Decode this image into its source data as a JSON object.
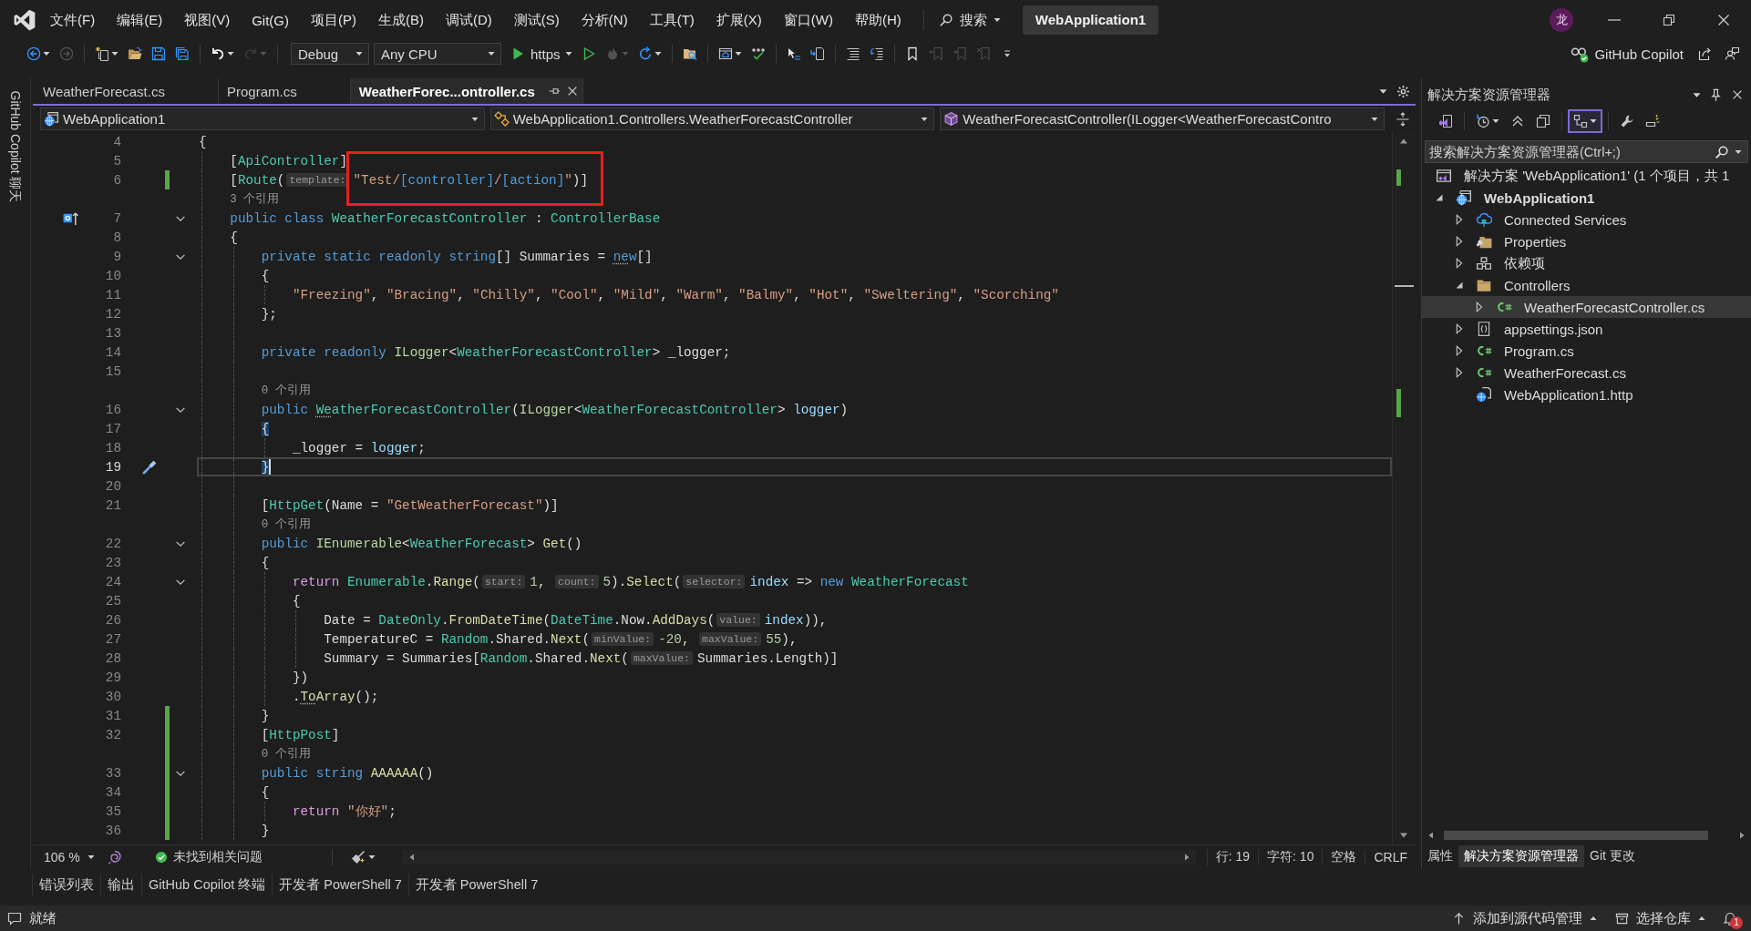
{
  "title_bar": {
    "menu": [
      "文件(F)",
      "编辑(E)",
      "视图(V)",
      "Git(G)",
      "项目(P)",
      "生成(B)",
      "调试(D)",
      "测试(S)",
      "分析(N)",
      "工具(T)",
      "扩展(X)",
      "窗口(W)",
      "帮助(H)"
    ],
    "search": "搜索",
    "solution": "WebApplication1",
    "avatar": "龙"
  },
  "toolbar": {
    "groups": [
      [
        {
          "kind": "back",
          "disabled": false,
          "menu": true
        },
        {
          "kind": "forward",
          "disabled": true
        }
      ],
      [
        {
          "kind": "new-item",
          "disabled": false,
          "menu": true
        },
        {
          "kind": "open",
          "disabled": false
        },
        {
          "kind": "save",
          "disabled": false
        },
        {
          "kind": "save-all",
          "disabled": false
        }
      ],
      [
        {
          "kind": "undo",
          "disabled": false,
          "menu": true
        },
        {
          "kind": "redo",
          "disabled": true,
          "menu": true
        }
      ],
      [
        {
          "kind": "config-combo",
          "label": "Debug"
        },
        {
          "kind": "platform-combo",
          "label": "Any CPU"
        },
        {
          "kind": "run",
          "label": "https",
          "disabled": false,
          "menu": true
        },
        {
          "kind": "run-outline",
          "disabled": false
        },
        {
          "kind": "hot-reload",
          "disabled": true,
          "menu": true
        },
        {
          "kind": "restart",
          "disabled": false,
          "menu": true
        }
      ],
      [
        {
          "kind": "find-files",
          "disabled": false
        }
      ],
      [
        {
          "kind": "browser",
          "disabled": false,
          "menu": true
        },
        {
          "kind": "spell-check",
          "disabled": false
        }
      ],
      [
        {
          "kind": "select-tool",
          "disabled": false
        },
        {
          "kind": "step-tool",
          "disabled": false
        }
      ],
      [
        {
          "kind": "comment",
          "disabled": false
        },
        {
          "kind": "uncomment",
          "disabled": false
        }
      ],
      [
        {
          "kind": "bookmark",
          "disabled": false
        },
        {
          "kind": "prev-bookmark",
          "disabled": true
        },
        {
          "kind": "next-bookmark",
          "disabled": true
        },
        {
          "kind": "clear-bookmarks",
          "disabled": true
        },
        {
          "kind": "overflow",
          "disabled": false
        }
      ]
    ],
    "copilot": "GitHub Copilot"
  },
  "side_strip": {
    "label": "GitHub Copilot 聊天"
  },
  "editor": {
    "tabs": [
      {
        "label": "WeatherForecast.cs",
        "selected": false
      },
      {
        "label": "Program.cs",
        "selected": false
      },
      {
        "label": "WeatherForec...ontroller.cs",
        "selected": true
      }
    ],
    "nav_bar": [
      {
        "kind": "project",
        "label": "WebApplication1"
      },
      {
        "kind": "type",
        "label": "WebApplication1.Controllers.WeatherForecastController"
      },
      {
        "kind": "member",
        "label": "WeatherForecastController(ILogger<WeatherForecastContro"
      }
    ],
    "lines": [
      {
        "kind": "code",
        "number": "4",
        "tokens": [
          {
            "kind": "plain",
            "text": "{"
          }
        ],
        "changed": false,
        "fold": false,
        "current": false,
        "children": [
          {
            "kind": "code",
            "number": "5",
            "tokens": [
              {
                "kind": "plain",
                "text": "["
              },
              {
                "kind": "type",
                "text": "ApiController"
              },
              {
                "kind": "plain",
                "text": "]"
              }
            ],
            "changed": false,
            "fold": false,
            "current": false
          },
          {
            "kind": "code",
            "number": "6",
            "tokens": [
              {
                "kind": "plain",
                "text": "["
              },
              {
                "kind": "type",
                "text": "Route"
              },
              {
                "kind": "plain",
                "text": "("
              },
              {
                "kind": "hint",
                "text": "template:"
              },
              {
                "kind": "str",
                "text": "\"Test/",
                "highlighted": true
              },
              {
                "kind": "route",
                "text": "[controller]",
                "highlighted": true
              },
              {
                "kind": "str",
                "text": "/",
                "highlighted": true
              },
              {
                "kind": "route",
                "text": "[action]",
                "highlighted": true
              },
              {
                "kind": "str",
                "text": "\"",
                "highlighted": true
              },
              {
                "kind": "plain",
                "text": ")]",
                "highlighted": true
              }
            ],
            "changed": true,
            "fold": false,
            "current": false
          },
          {
            "kind": "codelens",
            "text": "3 个引用",
            "changed": false
          },
          {
            "kind": "code",
            "number": "7",
            "tokens": [
              {
                "kind": "kw",
                "text": "public class "
              },
              {
                "kind": "type",
                "text": "WeatherForecastController"
              },
              {
                "kind": "plain",
                "text": " : "
              },
              {
                "kind": "type",
                "text": "ControllerBase"
              }
            ],
            "changed": false,
            "fold": true,
            "current": false,
            "glyph": {
              "kind": "implements"
            }
          },
          {
            "kind": "code",
            "number": "8",
            "tokens": [
              {
                "kind": "plain",
                "text": "{"
              }
            ],
            "changed": false,
            "fold": false,
            "current": false,
            "children": [
              {
                "kind": "code",
                "number": "9",
                "tokens": [
                  {
                    "kind": "kw",
                    "text": "private static readonly string"
                  },
                  {
                    "kind": "plain",
                    "text": "[] Summaries = "
                  },
                  {
                    "kind": "kw",
                    "text": "ne",
                    "dotted": true
                  },
                  {
                    "kind": "kw",
                    "text": "w"
                  },
                  {
                    "kind": "plain",
                    "text": "[]"
                  }
                ],
                "changed": false,
                "fold": true,
                "current": false
              },
              {
                "kind": "code",
                "number": "10",
                "tokens": [
                  {
                    "kind": "plain",
                    "text": "{"
                  }
                ],
                "changed": false,
                "fold": false,
                "current": false,
                "children": [
                  {
                    "kind": "code",
                    "number": "11",
                    "tokens": [
                      {
                        "kind": "str",
                        "text": "\"Freezing\""
                      },
                      {
                        "kind": "plain",
                        "text": ", "
                      },
                      {
                        "kind": "str",
                        "text": "\"Bracing\""
                      },
                      {
                        "kind": "plain",
                        "text": ", "
                      },
                      {
                        "kind": "str",
                        "text": "\"Chilly\""
                      },
                      {
                        "kind": "plain",
                        "text": ", "
                      },
                      {
                        "kind": "str",
                        "text": "\"Cool\""
                      },
                      {
                        "kind": "plain",
                        "text": ", "
                      },
                      {
                        "kind": "str",
                        "text": "\"Mild\""
                      },
                      {
                        "kind": "plain",
                        "text": ", "
                      },
                      {
                        "kind": "str",
                        "text": "\"Warm\""
                      },
                      {
                        "kind": "plain",
                        "text": ", "
                      },
                      {
                        "kind": "str",
                        "text": "\"Balmy\""
                      },
                      {
                        "kind": "plain",
                        "text": ", "
                      },
                      {
                        "kind": "str",
                        "text": "\"Hot\""
                      },
                      {
                        "kind": "plain",
                        "text": ", "
                      },
                      {
                        "kind": "str",
                        "text": "\"Sweltering\""
                      },
                      {
                        "kind": "plain",
                        "text": ", "
                      },
                      {
                        "kind": "str",
                        "text": "\"Scorching\""
                      }
                    ],
                    "changed": false,
                    "fold": false,
                    "current": false
                  }
                ]
              },
              {
                "kind": "code",
                "number": "12",
                "tokens": [
                  {
                    "kind": "plain",
                    "text": "};"
                  }
                ],
                "changed": false,
                "fold": false,
                "current": false
              },
              {
                "kind": "code",
                "number": "13",
                "changed": false,
                "fold": false,
                "current": false
              },
              {
                "kind": "code",
                "number": "14",
                "tokens": [
                  {
                    "kind": "kw",
                    "text": "private readonly "
                  },
                  {
                    "kind": "iface",
                    "text": "ILogger"
                  },
                  {
                    "kind": "plain",
                    "text": "<"
                  },
                  {
                    "kind": "type",
                    "text": "WeatherForecastController"
                  },
                  {
                    "kind": "plain",
                    "text": "> _logger;"
                  }
                ],
                "changed": false,
                "fold": false,
                "current": false
              },
              {
                "kind": "code",
                "number": "15",
                "changed": false,
                "fold": false,
                "current": false
              },
              {
                "kind": "codelens",
                "text": "0 个引用",
                "changed": false
              },
              {
                "kind": "code",
                "number": "16",
                "tokens": [
                  {
                    "kind": "kw",
                    "text": "public "
                  },
                  {
                    "kind": "type",
                    "text": "We",
                    "dotted": true
                  },
                  {
                    "kind": "type",
                    "text": "atherForecastController"
                  },
                  {
                    "kind": "plain",
                    "text": "("
                  },
                  {
                    "kind": "iface",
                    "text": "ILogger"
                  },
                  {
                    "kind": "plain",
                    "text": "<"
                  },
                  {
                    "kind": "type",
                    "text": "WeatherForecastController"
                  },
                  {
                    "kind": "plain",
                    "text": "> "
                  },
                  {
                    "kind": "param",
                    "text": "logger"
                  },
                  {
                    "kind": "plain",
                    "text": ")"
                  }
                ],
                "changed": false,
                "fold": true,
                "current": false
              },
              {
                "kind": "code",
                "number": "17",
                "tokens": [
                  {
                    "kind": "brace",
                    "text": "{"
                  }
                ],
                "changed": false,
                "fold": false,
                "current": false,
                "children": [
                  {
                    "kind": "code",
                    "number": "18",
                    "tokens": [
                      {
                        "kind": "plain",
                        "text": "_logger = "
                      },
                      {
                        "kind": "param",
                        "text": "logger"
                      },
                      {
                        "kind": "plain",
                        "text": ";"
                      }
                    ],
                    "changed": false,
                    "fold": false,
                    "current": false
                  }
                ]
              },
              {
                "kind": "code",
                "number": "19",
                "tokens": [
                  {
                    "kind": "brace",
                    "text": "}"
                  }
                ],
                "changed": false,
                "fold": false,
                "current": true,
                "glyph": {
                  "kind": "quick-action"
                }
              },
              {
                "kind": "code",
                "number": "20",
                "changed": false,
                "fold": false,
                "current": false
              },
              {
                "kind": "code",
                "number": "21",
                "tokens": [
                  {
                    "kind": "plain",
                    "text": "["
                  },
                  {
                    "kind": "type",
                    "text": "HttpGet"
                  },
                  {
                    "kind": "plain",
                    "text": "(Name = "
                  },
                  {
                    "kind": "str",
                    "text": "\"GetWeatherForecast\""
                  },
                  {
                    "kind": "plain",
                    "text": ")]"
                  }
                ],
                "changed": false,
                "fold": false,
                "current": false
              },
              {
                "kind": "codelens",
                "text": "0 个引用",
                "changed": false
              },
              {
                "kind": "code",
                "number": "22",
                "tokens": [
                  {
                    "kind": "kw",
                    "text": "public "
                  },
                  {
                    "kind": "iface",
                    "text": "IEnumerable"
                  },
                  {
                    "kind": "plain",
                    "text": "<"
                  },
                  {
                    "kind": "type",
                    "text": "WeatherForecast"
                  },
                  {
                    "kind": "plain",
                    "text": "> "
                  },
                  {
                    "kind": "method",
                    "text": "Get"
                  },
                  {
                    "kind": "plain",
                    "text": "()"
                  }
                ],
                "changed": false,
                "fold": true,
                "current": false
              },
              {
                "kind": "code",
                "number": "23",
                "tokens": [
                  {
                    "kind": "plain",
                    "text": "{"
                  }
                ],
                "changed": false,
                "fold": false,
                "current": false,
                "children": [
                  {
                    "kind": "code",
                    "number": "24",
                    "tokens": [
                      {
                        "kind": "ctrl",
                        "text": "return "
                      },
                      {
                        "kind": "type",
                        "text": "Enumerable"
                      },
                      {
                        "kind": "plain",
                        "text": "."
                      },
                      {
                        "kind": "method",
                        "text": "Range"
                      },
                      {
                        "kind": "plain",
                        "text": "("
                      },
                      {
                        "kind": "hint",
                        "text": "start:"
                      },
                      {
                        "kind": "num",
                        "text": "1"
                      },
                      {
                        "kind": "plain",
                        "text": ", "
                      },
                      {
                        "kind": "hint",
                        "text": "count:"
                      },
                      {
                        "kind": "num",
                        "text": "5"
                      },
                      {
                        "kind": "plain",
                        "text": ")."
                      },
                      {
                        "kind": "method",
                        "text": "Select"
                      },
                      {
                        "kind": "plain",
                        "text": "("
                      },
                      {
                        "kind": "hint",
                        "text": "selector:"
                      },
                      {
                        "kind": "param",
                        "text": "index"
                      },
                      {
                        "kind": "plain",
                        "text": " => "
                      },
                      {
                        "kind": "kw",
                        "text": "new "
                      },
                      {
                        "kind": "type",
                        "text": "WeatherForecast"
                      }
                    ],
                    "changed": false,
                    "fold": true,
                    "current": false
                  },
                  {
                    "kind": "code",
                    "number": "25",
                    "tokens": [
                      {
                        "kind": "plain",
                        "text": "{"
                      }
                    ],
                    "changed": false,
                    "fold": false,
                    "current": false,
                    "children": [
                      {
                        "kind": "code",
                        "number": "26",
                        "tokens": [
                          {
                            "kind": "plain",
                            "text": "Date = "
                          },
                          {
                            "kind": "type",
                            "text": "DateOnly"
                          },
                          {
                            "kind": "plain",
                            "text": "."
                          },
                          {
                            "kind": "method",
                            "text": "FromDateTime"
                          },
                          {
                            "kind": "plain",
                            "text": "("
                          },
                          {
                            "kind": "type",
                            "text": "DateTime"
                          },
                          {
                            "kind": "plain",
                            "text": ".Now."
                          },
                          {
                            "kind": "method",
                            "text": "AddDays"
                          },
                          {
                            "kind": "plain",
                            "text": "("
                          },
                          {
                            "kind": "hint",
                            "text": "value:"
                          },
                          {
                            "kind": "param",
                            "text": "index"
                          },
                          {
                            "kind": "plain",
                            "text": ")),"
                          }
                        ],
                        "changed": false,
                        "fold": false,
                        "current": false
                      },
                      {
                        "kind": "code",
                        "number": "27",
                        "tokens": [
                          {
                            "kind": "plain",
                            "text": "TemperatureC = "
                          },
                          {
                            "kind": "type",
                            "text": "Random"
                          },
                          {
                            "kind": "plain",
                            "text": ".Shared."
                          },
                          {
                            "kind": "method",
                            "text": "Next"
                          },
                          {
                            "kind": "plain",
                            "text": "("
                          },
                          {
                            "kind": "hint",
                            "text": "minValue:"
                          },
                          {
                            "kind": "num",
                            "text": "-20"
                          },
                          {
                            "kind": "plain",
                            "text": ", "
                          },
                          {
                            "kind": "hint",
                            "text": "maxValue:"
                          },
                          {
                            "kind": "num",
                            "text": "55"
                          },
                          {
                            "kind": "plain",
                            "text": "),"
                          }
                        ],
                        "changed": false,
                        "fold": false,
                        "current": false
                      },
                      {
                        "kind": "code",
                        "number": "28",
                        "tokens": [
                          {
                            "kind": "plain",
                            "text": "Summary = Summaries["
                          },
                          {
                            "kind": "type",
                            "text": "Random"
                          },
                          {
                            "kind": "plain",
                            "text": ".Shared."
                          },
                          {
                            "kind": "method",
                            "text": "Next"
                          },
                          {
                            "kind": "plain",
                            "text": "("
                          },
                          {
                            "kind": "hint",
                            "text": "maxValue:"
                          },
                          {
                            "kind": "plain",
                            "text": "Summaries.Length)]"
                          }
                        ],
                        "changed": false,
                        "fold": false,
                        "current": false
                      }
                    ]
                  },
                  {
                    "kind": "code",
                    "number": "29",
                    "tokens": [
                      {
                        "kind": "plain",
                        "text": "})"
                      }
                    ],
                    "changed": false,
                    "fold": false,
                    "current": false
                  },
                  {
                    "kind": "code",
                    "number": "30",
                    "tokens": [
                      {
                        "kind": "plain",
                        "text": "."
                      },
                      {
                        "kind": "method",
                        "text": "To",
                        "dotted": true
                      },
                      {
                        "kind": "method",
                        "text": "Array"
                      },
                      {
                        "kind": "plain",
                        "text": "();"
                      }
                    ],
                    "changed": false,
                    "fold": false,
                    "current": false
                  }
                ]
              },
              {
                "kind": "code",
                "number": "31",
                "tokens": [
                  {
                    "kind": "plain",
                    "text": "}"
                  }
                ],
                "changed": true,
                "fold": false,
                "current": false
              },
              {
                "kind": "code",
                "number": "32",
                "tokens": [
                  {
                    "kind": "plain",
                    "text": "["
                  },
                  {
                    "kind": "type",
                    "text": "HttpPost"
                  },
                  {
                    "kind": "plain",
                    "text": "]"
                  }
                ],
                "changed": true,
                "fold": false,
                "current": false
              },
              {
                "kind": "codelens",
                "text": "0 个引用",
                "changed": true
              },
              {
                "kind": "code",
                "number": "33",
                "tokens": [
                  {
                    "kind": "kw",
                    "text": "public string "
                  },
                  {
                    "kind": "method",
                    "text": "AAAAAA"
                  },
                  {
                    "kind": "plain",
                    "text": "()"
                  }
                ],
                "changed": true,
                "fold": true,
                "current": false
              },
              {
                "kind": "code",
                "number": "34",
                "tokens": [
                  {
                    "kind": "plain",
                    "text": "{"
                  }
                ],
                "changed": true,
                "fold": false,
                "current": false,
                "children": [
                  {
                    "kind": "code",
                    "number": "35",
                    "tokens": [
                      {
                        "kind": "ctrl",
                        "text": "return "
                      },
                      {
                        "kind": "str",
                        "text": "\"你好\""
                      },
                      {
                        "kind": "plain",
                        "text": ";"
                      }
                    ],
                    "changed": true,
                    "fold": false,
                    "current": false
                  }
                ]
              },
              {
                "kind": "code",
                "number": "36",
                "tokens": [
                  {
                    "kind": "plain",
                    "text": "}"
                  }
                ],
                "changed": true,
                "fold": false,
                "current": false
              }
            ]
          }
        ]
      }
    ],
    "status": {
      "zoom": "106 %",
      "issues": "未找到相关问题",
      "line": "行: 19",
      "column": "字符: 10",
      "whitespace": "空格",
      "line_ending": "CRLF"
    }
  },
  "tool_windows": [
    {
      "label": "错误列表"
    },
    {
      "label": "输出"
    },
    {
      "label": "GitHub Copilot 终端"
    },
    {
      "label": "开发者 PowerShell 7"
    },
    {
      "label": "开发者 PowerShell 7"
    }
  ],
  "solution_explorer": {
    "title": "解决方案资源管理器",
    "tools": [
      [
        {
          "kind": "switch-views",
          "on": false
        }
      ],
      [
        {
          "kind": "history",
          "on": false,
          "menu": true
        },
        {
          "kind": "collapse",
          "on": false
        },
        {
          "kind": "show-all",
          "on": false
        }
      ],
      [
        {
          "kind": "sync",
          "on": true,
          "menu": true
        }
      ],
      [
        {
          "kind": "properties",
          "on": false
        },
        {
          "kind": "preview",
          "on": false
        }
      ]
    ],
    "search": {
      "placeholder": "搜索解决方案资源管理器(Ctrl+;)"
    },
    "tree": [
      {
        "label": "解决方案 'WebApplication1' (1 个项目，共 1",
        "kind": "solution",
        "selected": false,
        "bold": false,
        "children": [
          {
            "label": "WebApplication1",
            "kind": "web-project",
            "expanded": true,
            "selected": false,
            "bold": true,
            "children": [
              {
                "label": "Connected Services",
                "kind": "connected-services",
                "expanded": false,
                "selected": false,
                "bold": false
              },
              {
                "label": "Properties",
                "kind": "properties-folder",
                "expanded": false,
                "selected": false,
                "bold": false
              },
              {
                "label": "依赖项",
                "kind": "dependencies",
                "expanded": false,
                "selected": false,
                "bold": false
              },
              {
                "label": "Controllers",
                "kind": "folder",
                "expanded": true,
                "selected": false,
                "bold": false,
                "children": [
                  {
                    "label": "WeatherForecastController.cs",
                    "kind": "csharp",
                    "expanded": false,
                    "selected": true,
                    "bold": false
                  }
                ]
              },
              {
                "label": "appsettings.json",
                "kind": "json",
                "expanded": false,
                "selected": false,
                "bold": false
              },
              {
                "label": "Program.cs",
                "kind": "csharp",
                "expanded": false,
                "selected": false,
                "bold": false
              },
              {
                "label": "WeatherForecast.cs",
                "kind": "csharp",
                "expanded": false,
                "selected": false,
                "bold": false
              },
              {
                "label": "WebApplication1.http",
                "kind": "http",
                "selected": false,
                "bold": false
              }
            ]
          }
        ]
      }
    ],
    "tabs": [
      {
        "label": "属性",
        "selected": false
      },
      {
        "label": "解决方案资源管理器",
        "selected": true
      },
      {
        "label": "Git 更改",
        "selected": false
      }
    ]
  },
  "status_bar": {
    "text": "就绪",
    "source_control": "添加到源代码管理",
    "repository": "选择仓库",
    "notifications": "1"
  }
}
